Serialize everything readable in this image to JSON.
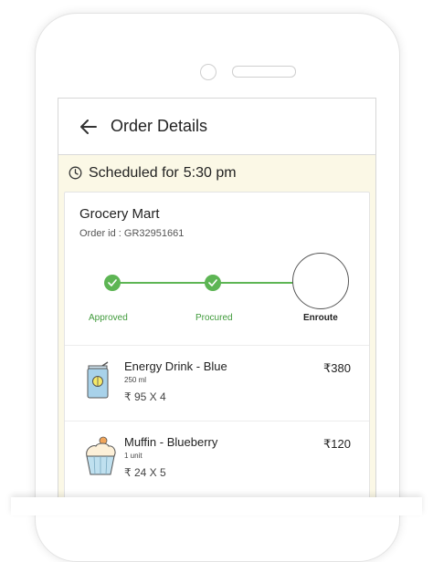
{
  "header": {
    "title": "Order Details"
  },
  "schedule": {
    "label": "Scheduled for",
    "time": "5:30 pm"
  },
  "order": {
    "store": "Grocery Mart",
    "order_id": "Order id : GR32951661"
  },
  "tracker": {
    "steps": [
      {
        "label": "Approved",
        "state": "done"
      },
      {
        "label": "Procured",
        "state": "done"
      },
      {
        "label": "Enroute",
        "state": "current"
      }
    ],
    "colors": {
      "done": "#5db554",
      "current": "#222222"
    }
  },
  "items": [
    {
      "name": "Energy Drink - Blue",
      "quantity": "250 ml",
      "calc": "₹ 95 X 4",
      "price": "₹380",
      "icon": "energy-drink-can-icon"
    },
    {
      "name": "Muffin - Blueberry",
      "quantity": "1 unit",
      "calc": "₹ 24 X 5",
      "price": "₹120",
      "icon": "muffin-icon"
    }
  ],
  "colors": {
    "accent": "#5db554",
    "background": "#fbf8e6"
  }
}
